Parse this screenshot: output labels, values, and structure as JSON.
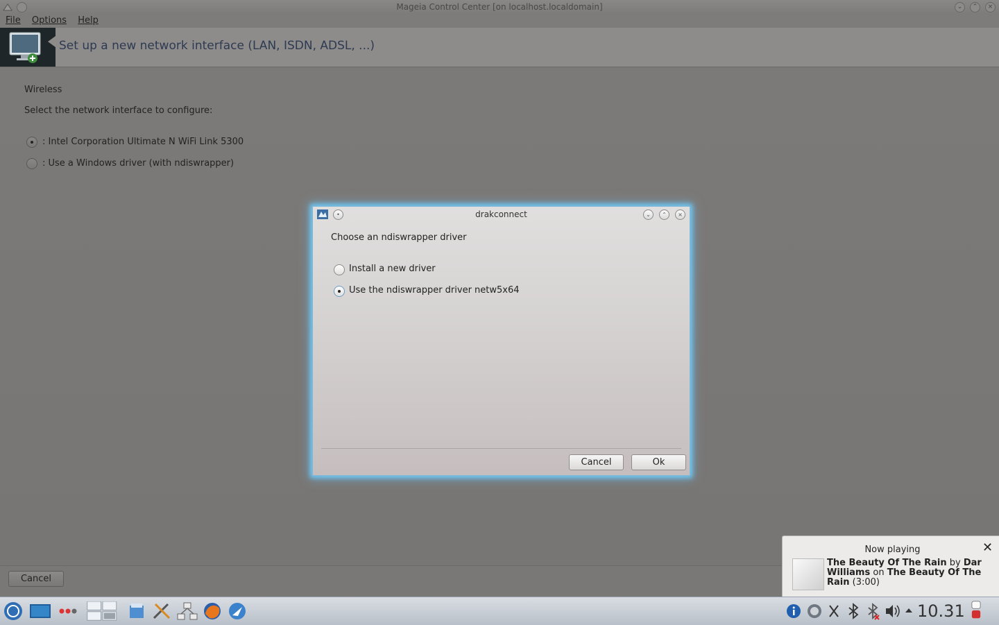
{
  "window": {
    "title": "Mageia Control Center  [on localhost.localdomain]"
  },
  "menu": {
    "file": "File",
    "options": "Options",
    "help": "Help"
  },
  "banner": {
    "title": "Set up a new network interface (LAN, ISDN, ADSL, ...)"
  },
  "main": {
    "section": "Wireless",
    "prompt": "Select the network interface to configure:",
    "options": [
      {
        "label": ": Intel Corporation Ultimate N WiFi Link 5300",
        "selected": true
      },
      {
        "label": ": Use a Windows driver (with ndiswrapper)",
        "selected": false
      }
    ],
    "cancel_label": "Cancel"
  },
  "dialog": {
    "title": "drakconnect",
    "prompt": "Choose an ndiswrapper driver",
    "options": [
      {
        "label": "Install a new driver",
        "selected": false
      },
      {
        "label": "Use the ndiswrapper driver netw5x64",
        "selected": true
      }
    ],
    "cancel_label": "Cancel",
    "ok_label": "Ok"
  },
  "now_playing": {
    "heading": "Now playing",
    "track": "The Beauty Of The Rain",
    "by": "by",
    "artist": "Dar Williams",
    "on": "on",
    "album": "The Beauty Of The Rain",
    "duration": "(3:00)"
  },
  "taskbar": {
    "clock": "10.31",
    "icons": [
      "kde-menu-icon",
      "desktop-icon",
      "activities-icon",
      "pager-icon",
      "pager-icon-2",
      "file-manager-icon",
      "tools-icon",
      "network-icon",
      "firefox-icon",
      "mail-icon"
    ],
    "tray_icons": [
      "info-icon",
      "network-tray-icon",
      "scissors-icon",
      "bluetooth-icon",
      "bluetooth-off-icon",
      "volume-icon",
      "arrow-up-icon",
      "lock-icon"
    ]
  }
}
